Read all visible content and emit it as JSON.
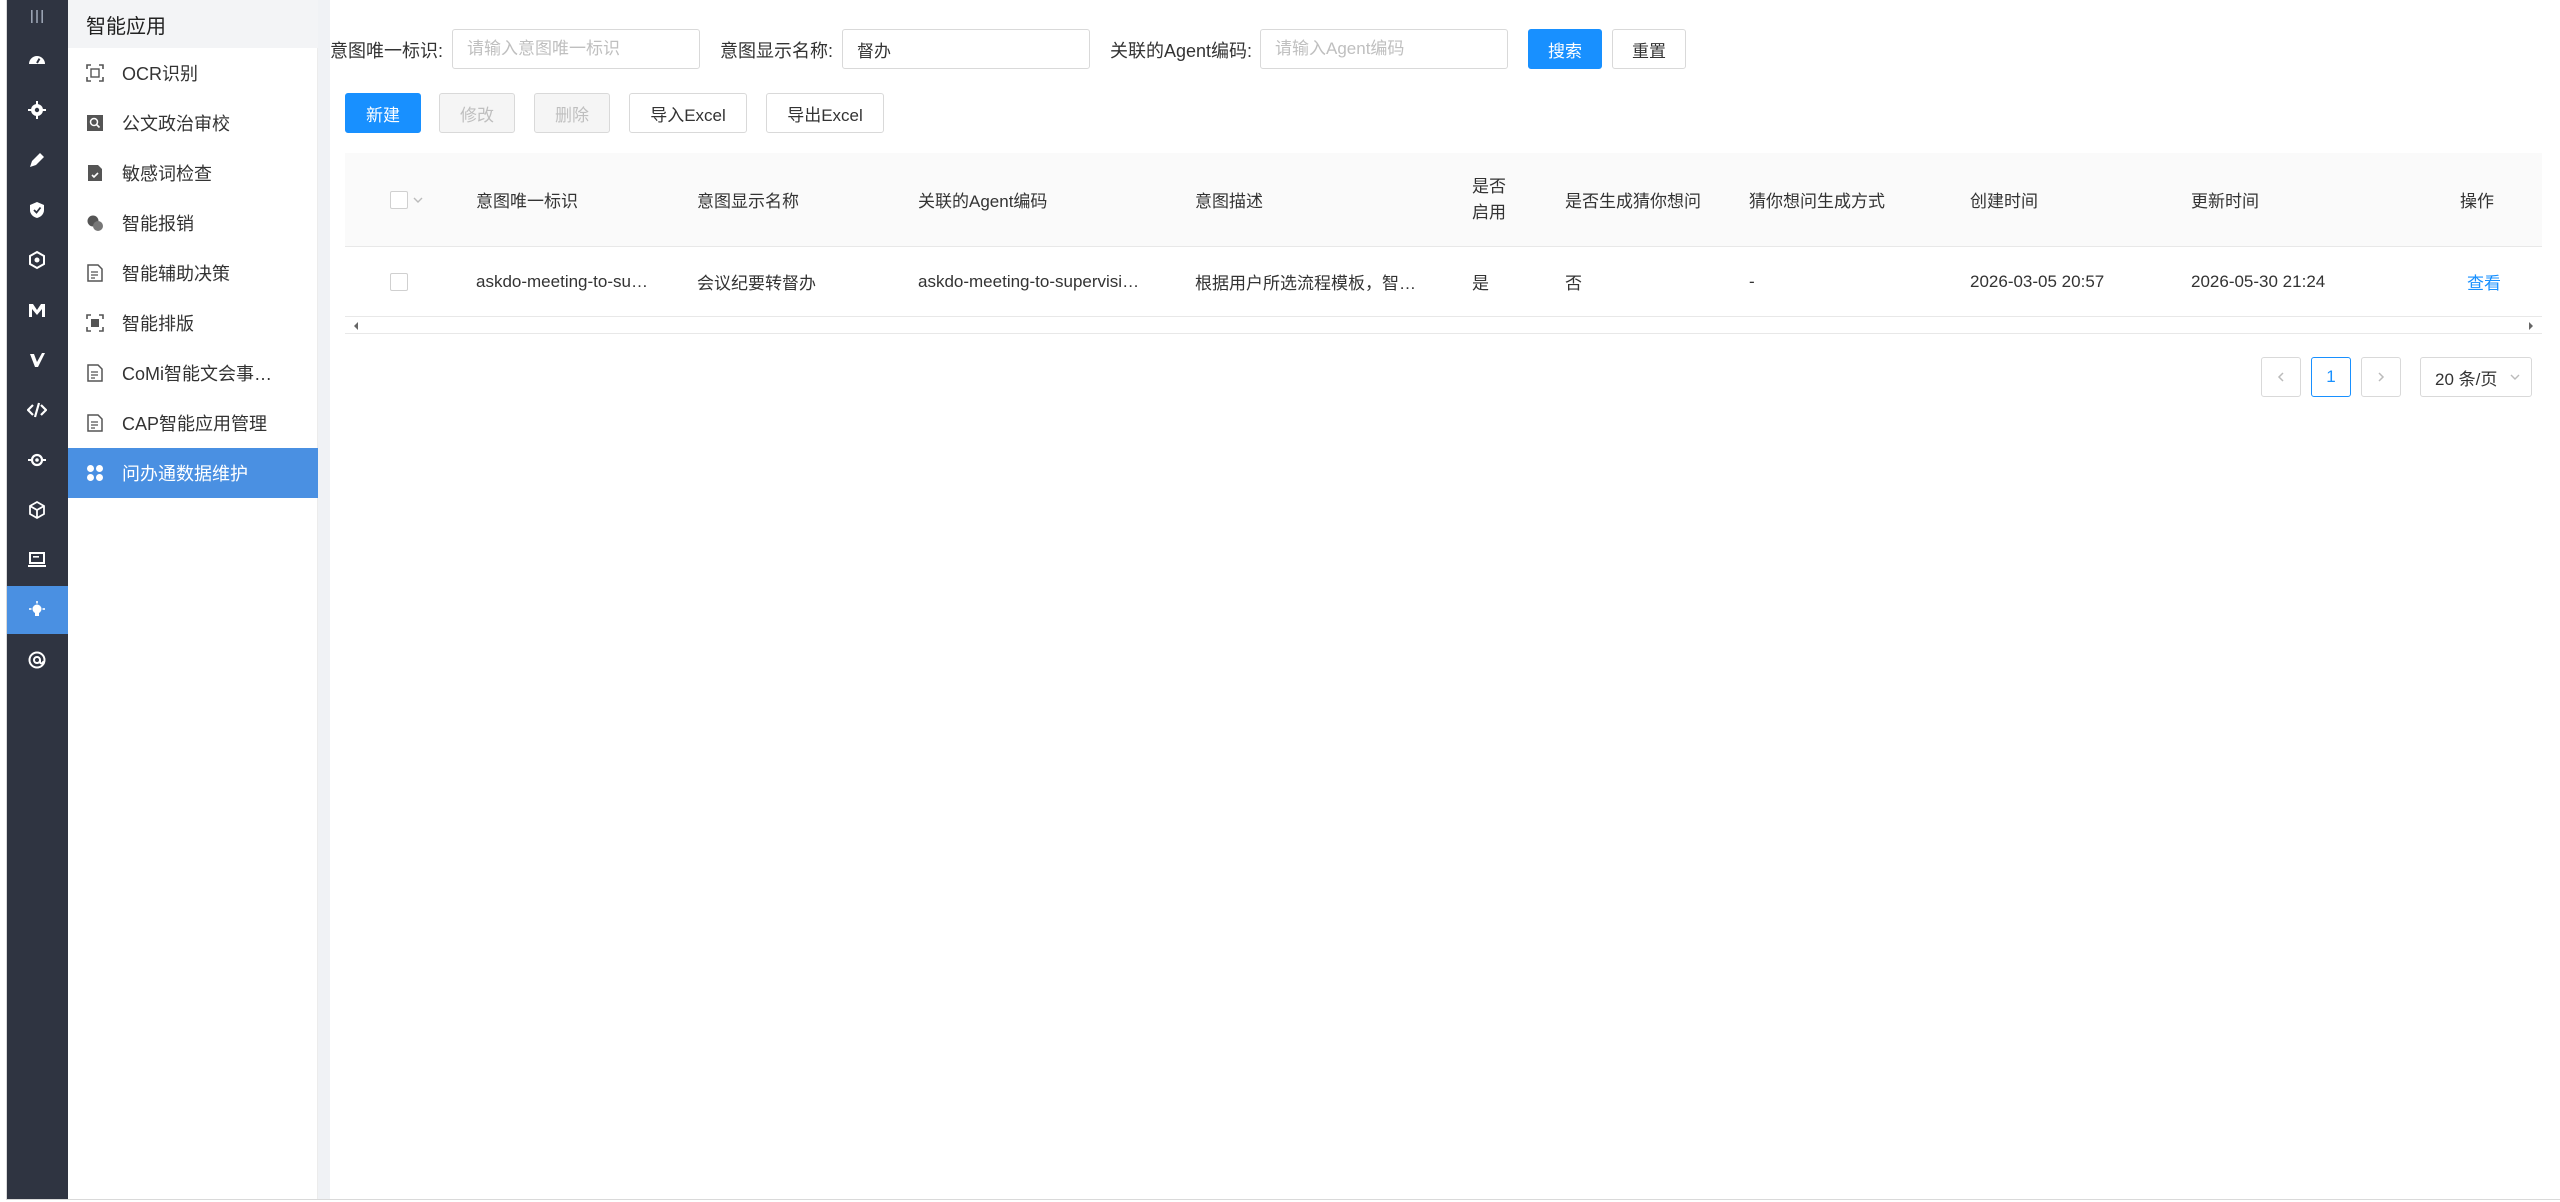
{
  "sidebar": {
    "title": "智能应用",
    "items": [
      {
        "label": "OCR识别",
        "icon": "ocr-scan-icon"
      },
      {
        "label": "公文政治审校",
        "icon": "search-document-icon"
      },
      {
        "label": "敏感词检查",
        "icon": "document-check-icon"
      },
      {
        "label": "智能报销",
        "icon": "coins-icon"
      },
      {
        "label": "智能辅助决策",
        "icon": "document-icon"
      },
      {
        "label": "智能排版",
        "icon": "layout-scan-icon"
      },
      {
        "label": "CoMi智能文会事…",
        "icon": "document-icon"
      },
      {
        "label": "CAP智能应用管理",
        "icon": "document-icon"
      },
      {
        "label": "问办通数据维护",
        "icon": "grid-circles-icon",
        "active": true
      }
    ]
  },
  "rail": {
    "icons": [
      "menu-toggle-icon",
      "dashboard-icon",
      "settings-gear-icon",
      "edit-icon",
      "shield-check-icon",
      "hexagon-icon",
      "m-logo-icon",
      "v-logo-icon",
      "code-icon",
      "chip-gear-icon",
      "cube-icon",
      "monitor-icon",
      "lightbulb-icon",
      "at-sign-icon"
    ],
    "active_index": 12
  },
  "filters": {
    "intent_id_label": "意图唯一标识:",
    "intent_id_placeholder": "请输入意图唯一标识",
    "intent_id_value": "",
    "intent_name_label": "意图显示名称:",
    "intent_name_placeholder": "",
    "intent_name_value": "督办",
    "agent_code_label": "关联的Agent编码:",
    "agent_code_placeholder": "请输入Agent编码",
    "agent_code_value": "",
    "search_label": "搜索",
    "reset_label": "重置"
  },
  "toolbar": {
    "new_label": "新建",
    "edit_label": "修改",
    "delete_label": "删除",
    "import_label": "导入Excel",
    "export_label": "导出Excel"
  },
  "table": {
    "headers": [
      "意图唯一标识",
      "意图显示名称",
      "关联的Agent编码",
      "意图描述",
      "是否启用",
      "是否生成猜你想问",
      "猜你想问生成方式",
      "创建时间",
      "更新时间",
      "操作"
    ],
    "rows": [
      {
        "intent_id": "askdo-meeting-to-su…",
        "intent_name": "会议纪要转督办",
        "agent_code": "askdo-meeting-to-supervisi…",
        "description": "根据用户所选流程模板，智…",
        "enabled": "是",
        "gen_guess": "否",
        "guess_mode": "-",
        "created": "2026-03-05 20:57",
        "updated": "2026-05-30 21:24",
        "action": "查看"
      }
    ]
  },
  "pagination": {
    "current_page": "1",
    "page_size": "20 条/页"
  },
  "colors": {
    "primary": "#1890ff",
    "rail_bg": "#2f3441",
    "active_item": "#4a90e2"
  }
}
